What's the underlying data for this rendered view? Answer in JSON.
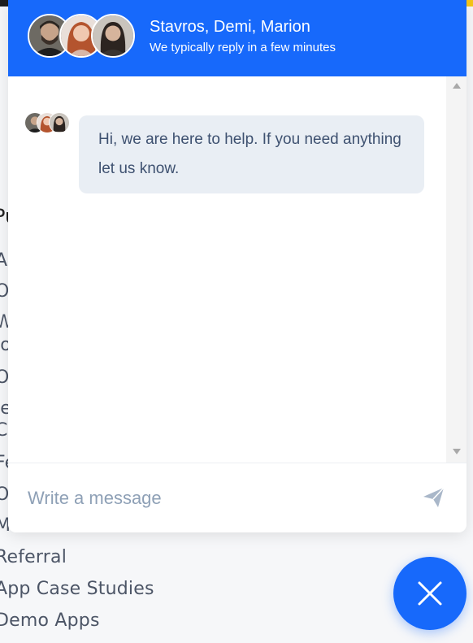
{
  "colors": {
    "brand": "#1769fb",
    "bubble_bg": "#e9eef4",
    "bubble_text": "#3e5170",
    "placeholder": "#8ea0b6",
    "page_bg": "#f6f7f9"
  },
  "chat": {
    "header": {
      "names": "Stavros, Demi, Marion",
      "subtitle": "We typically reply in a few minutes",
      "avatars": [
        "avatar-stavros",
        "avatar-demi",
        "avatar-marion"
      ]
    },
    "messages": [
      {
        "from": "team",
        "text": "Hi, we are here to help. If you need anything let us know."
      }
    ],
    "composer": {
      "placeholder": "Write a message",
      "value": "",
      "send_icon": "send-icon"
    },
    "toggle_icon": "close-icon"
  },
  "background_page": {
    "heading": "Pu",
    "items": [
      "An",
      "O",
      "W",
      "lo",
      "Ot",
      "le",
      "Co",
      "Fe",
      "Ot",
      "M",
      "Referral",
      "App Case Studies",
      "Demo Apps"
    ]
  }
}
